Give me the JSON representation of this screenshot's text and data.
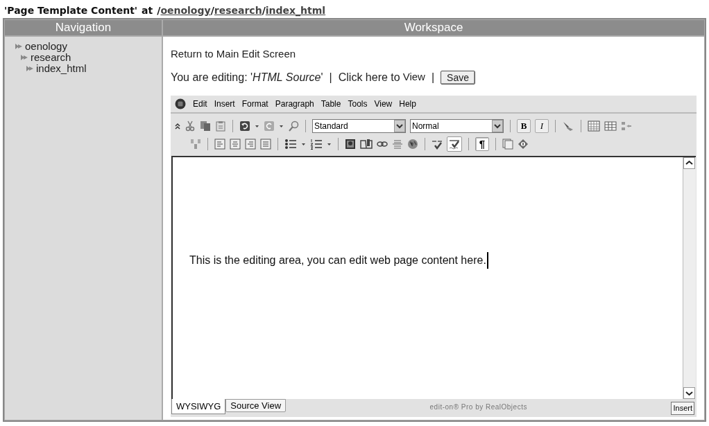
{
  "page_title": {
    "name": "'Page Template Content'",
    "at": "at",
    "separator": "/",
    "path": [
      "oenology",
      "research",
      "index_html"
    ]
  },
  "navigation": {
    "header": "Navigation",
    "tree": [
      {
        "label": "oenology",
        "children": [
          {
            "label": "research",
            "children": [
              {
                "label": "index_html"
              }
            ]
          }
        ]
      }
    ]
  },
  "workspace": {
    "header": "Workspace",
    "return_link": "Return to Main Edit Screen",
    "editing_prefix": "You are editing: '",
    "editing_name": "HTML Source",
    "editing_suffix": "'",
    "divider": "|",
    "view_prefix": "Click here to",
    "view_link": "View",
    "save_button": "Save"
  },
  "editor": {
    "menu": [
      "Edit",
      "Insert",
      "Format",
      "Paragraph",
      "Table",
      "Tools",
      "View",
      "Help"
    ],
    "style_select": "Standard",
    "paragraph_select": "Normal",
    "format_buttons": [
      {
        "label": "B",
        "pressed": false
      },
      {
        "label": "I",
        "pressed": false
      }
    ],
    "auto_spellcheck_pressed": true,
    "pilcrow_button": {
      "label": "¶",
      "pressed": true
    },
    "content": "This is the editing area, you can edit web page content here.",
    "tabs": [
      {
        "label": "WYSIWYG",
        "selected": true
      },
      {
        "label": "Source View",
        "selected": false
      }
    ],
    "credit": "edit-on® Pro by RealObjects",
    "mode": "Insert"
  }
}
